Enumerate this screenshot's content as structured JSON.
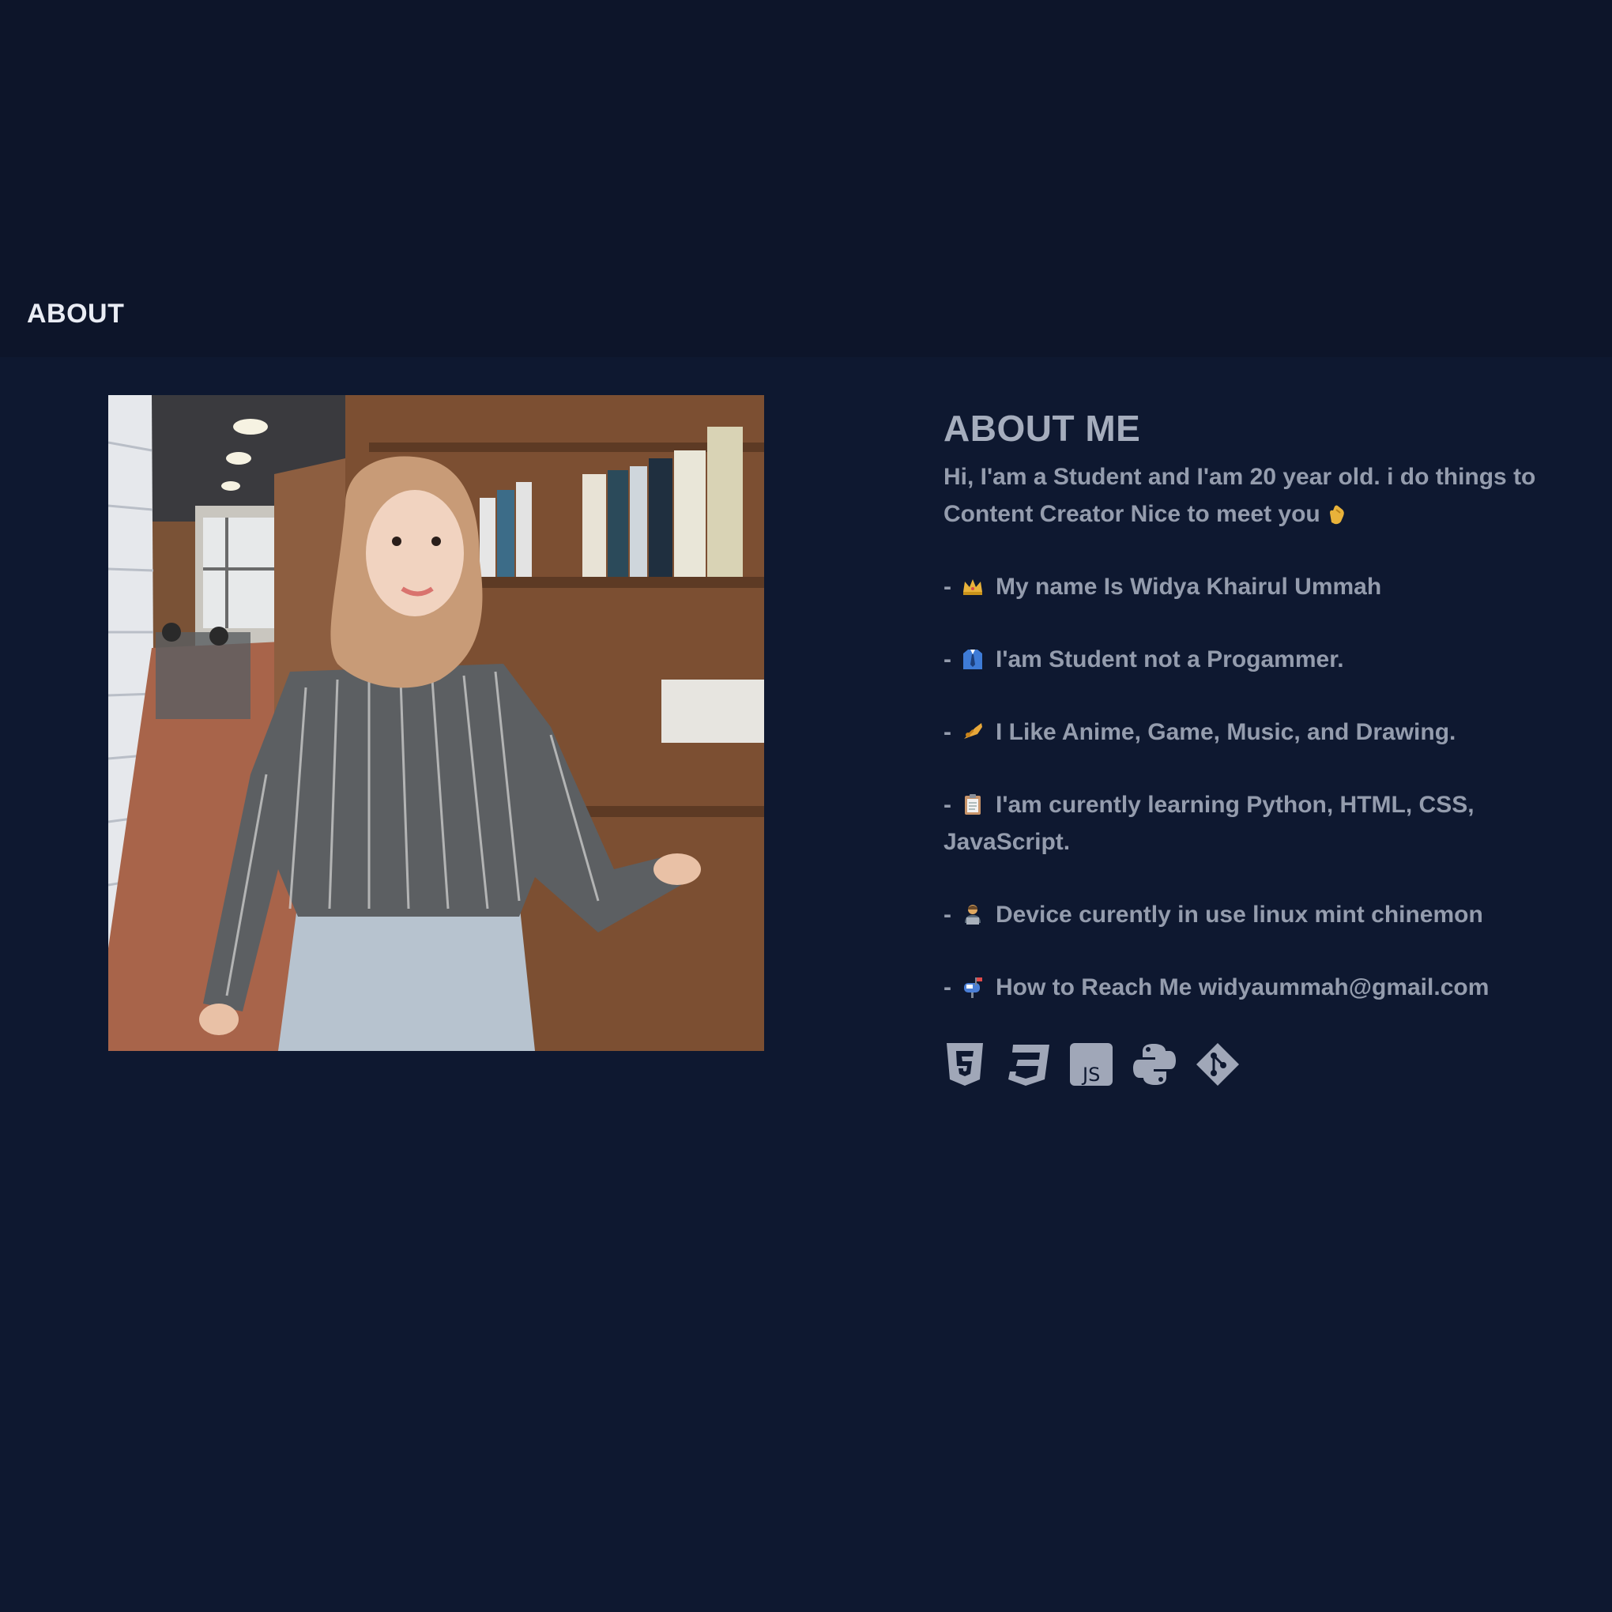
{
  "nav": {
    "title": "ABOUT"
  },
  "about": {
    "heading": "ABOUT ME",
    "intro": "Hi, I'am a Student and I'am 20 year old. i do things to Content Creator Nice to meet you",
    "intro_emoji": "clapping-hands",
    "facts": [
      {
        "dash": "-",
        "emoji": "crown",
        "text": "My name Is Widya Khairul Ummah"
      },
      {
        "dash": "-",
        "emoji": "shirt-tie",
        "text": "I'am Student not a Progammer."
      },
      {
        "dash": "-",
        "emoji": "trumpet",
        "text": "I Like Anime, Game, Music, and Drawing."
      },
      {
        "dash": "-",
        "emoji": "clipboard",
        "text": "I'am curently learning Python, HTML, CSS, JavaScript."
      },
      {
        "dash": "-",
        "emoji": "technologist",
        "text": "Device curently in use linux mint chinemon"
      },
      {
        "dash": "-",
        "emoji": "mailbox",
        "text": "How to Reach Me widyaummah@gmail.com"
      }
    ]
  },
  "tech_icons": [
    {
      "name": "html5-icon"
    },
    {
      "name": "css3-icon"
    },
    {
      "name": "javascript-icon",
      "label": "JS"
    },
    {
      "name": "python-icon"
    },
    {
      "name": "git-icon"
    }
  ],
  "colors": {
    "topbar": "#0d152a",
    "background": "#0e1830",
    "nav_text": "#e9ecf4",
    "body_text": "#949cad",
    "icon": "#a0a7b8"
  }
}
